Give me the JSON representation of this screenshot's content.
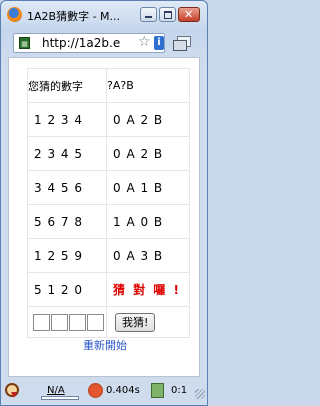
{
  "window": {
    "title": "1A2B猜數字 - M..."
  },
  "address": {
    "url": "http://1a2b.e"
  },
  "board": {
    "header": {
      "guess_col": "您猜的數字",
      "result_col": "?A?B"
    },
    "rows": [
      {
        "guess": "1 2 3 4",
        "result": "0 A 2 B"
      },
      {
        "guess": "2 3 4 5",
        "result": "0 A 2 B"
      },
      {
        "guess": "3 4 5 6",
        "result": "0 A 1 B"
      },
      {
        "guess": "5 6 7 8",
        "result": "1 A 0 B"
      },
      {
        "guess": "1 2 5 9",
        "result": "0 A 3 B"
      },
      {
        "guess": "5 1 2 0",
        "result": "猜 對 囉 !"
      }
    ],
    "guess_button": "我猜!",
    "win_color": "#e00000"
  },
  "restart_link": "重新開始",
  "status": {
    "yslow_value": "N/A",
    "load_time": "0.404s",
    "ratio": "0:1"
  },
  "icons": {
    "app": "firefox-icon",
    "page": "page-icon",
    "bookmark": "star-icon",
    "info": "info-icon",
    "tabs": "tabs-icon",
    "yslow": "yslow-icon",
    "firebug": "bug-icon",
    "notes": "note-icon"
  }
}
